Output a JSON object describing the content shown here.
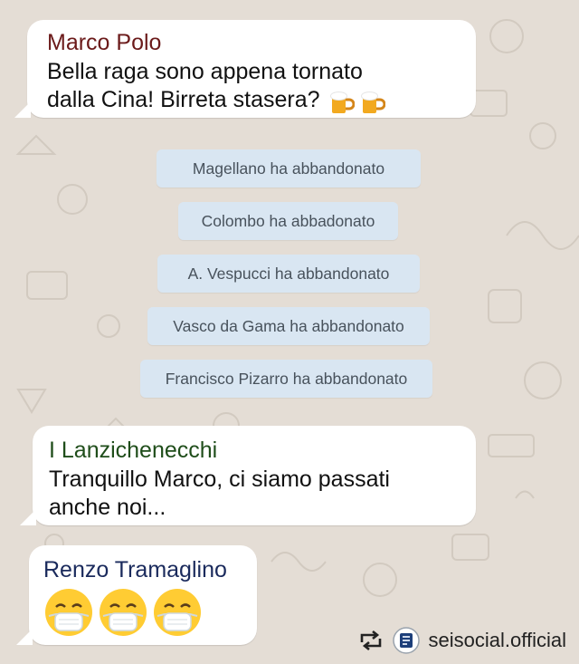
{
  "chat": {
    "messages": [
      {
        "sender": "Marco Polo",
        "line1": "Bella raga sono appena tornato",
        "line2": "dalla Cina! Birreta stasera?",
        "emoji": "beer-icon"
      },
      {
        "sender": "I Lanzichenecchi",
        "line1": "Tranquillo Marco, ci siamo passati",
        "line2": "anche noi..."
      },
      {
        "sender": "Renzo Tramaglino",
        "emoji": "mask-face-icon"
      }
    ],
    "system_notices": [
      "Magellano ha abbandonato",
      "Colombo ha abbadonato",
      "A. Vespucci ha abbandonato",
      "Vasco da Gama ha abbandonato",
      "Francisco Pizarro ha abbandonato"
    ]
  },
  "footer": {
    "handle": "seisocial.official",
    "icons": [
      "repost-icon",
      "profile-logo-icon"
    ]
  },
  "colors": {
    "background": "#e4ddd5",
    "bubble": "#ffffff",
    "system_bubble": "#d9e6f2",
    "sender_marco": "#6b1a1a",
    "sender_lanzi": "#1f4d1a",
    "sender_renzo": "#1a2a5c"
  }
}
